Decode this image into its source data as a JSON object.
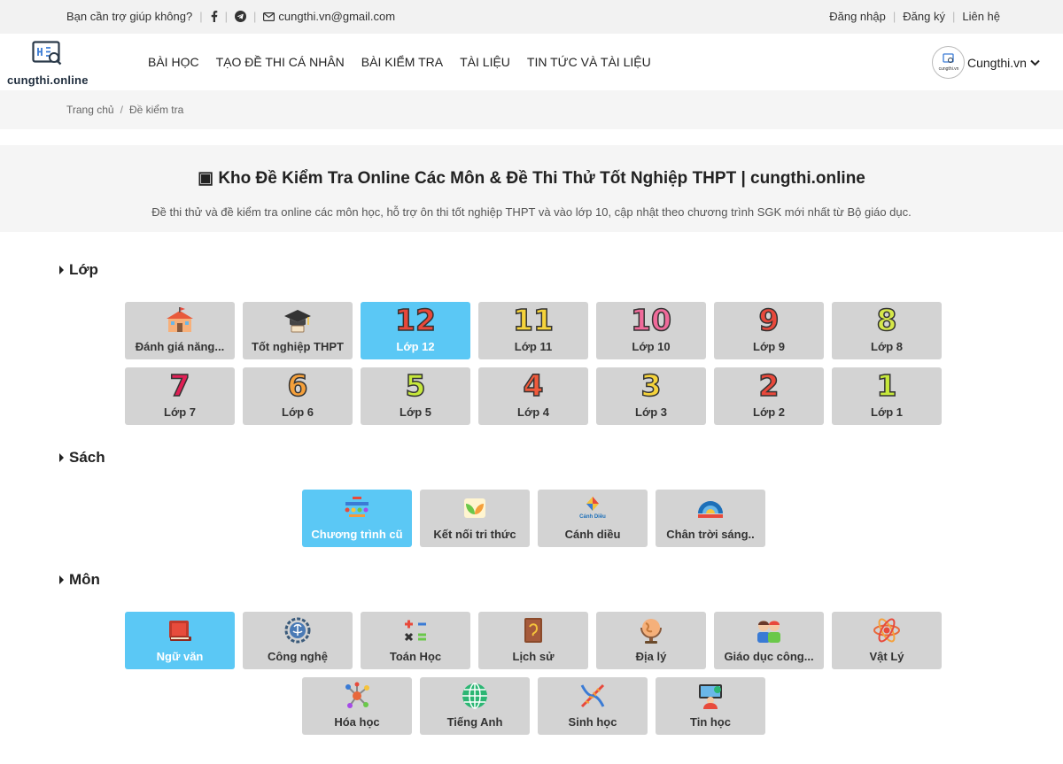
{
  "topbar": {
    "help_text": "Bạn cần trợ giúp không?",
    "email": "cungthi.vn@gmail.com",
    "login": "Đăng nhập",
    "register": "Đăng ký",
    "contact": "Liên hệ"
  },
  "header": {
    "logo_text": "cungthi.online",
    "nav": [
      "BÀI HỌC",
      "TẠO ĐỀ THI CÁ NHÂN",
      "BÀI KIỂM TRA",
      "TÀI LIỆU",
      "TIN TỨC VÀ TÀI LIỆU"
    ],
    "account_name": "Cungthi.vn",
    "avatar_text": "cungthi.vn"
  },
  "breadcrumb": {
    "home": "Trang chủ",
    "current": "Đề kiểm tra"
  },
  "hero": {
    "title": "▣ Kho Đề Kiểm Tra Online Các Môn & Đề Thi Thử Tốt Nghiệp THPT | cungthi.online",
    "subtitle": "Đề thi thử và đề kiểm tra online các môn học, hỗ trợ ôn thi tốt nghiệp THPT và vào lớp 10, cập nhật theo chương trình SGK mới nhất từ Bộ giáo dục."
  },
  "sections": {
    "grades": "Lớp",
    "books": "Sách",
    "subjects": "Môn"
  },
  "grades": [
    {
      "label": "Đánh giá năng...",
      "icon": "school-building-icon"
    },
    {
      "label": "Tốt nghiệp THPT",
      "icon": "graduation-cap-icon"
    },
    {
      "label": "Lớp 12",
      "num": "12",
      "color": "#e8483b",
      "active": true
    },
    {
      "label": "Lớp 11",
      "num": "11",
      "color": "#f5d33b"
    },
    {
      "label": "Lớp 10",
      "num": "10",
      "color": "#f06a9a"
    },
    {
      "label": "Lớp 9",
      "num": "9",
      "color": "#e8483b"
    },
    {
      "label": "Lớp 8",
      "num": "8",
      "color": "#d6e84a"
    },
    {
      "label": "Lớp 7",
      "num": "7",
      "color": "#e01f55"
    },
    {
      "label": "Lớp 6",
      "num": "6",
      "color": "#f5a03b"
    },
    {
      "label": "Lớp 5",
      "num": "5",
      "color": "#c6e83b"
    },
    {
      "label": "Lớp 4",
      "num": "4",
      "color": "#f05a3b"
    },
    {
      "label": "Lớp 3",
      "num": "3",
      "color": "#f5d33b"
    },
    {
      "label": "Lớp 2",
      "num": "2",
      "color": "#e8483b"
    },
    {
      "label": "Lớp 1",
      "num": "1",
      "color": "#c6e83b"
    }
  ],
  "books": [
    {
      "label": "Chương trình cũ",
      "icon": "old-curriculum-icon",
      "active": true
    },
    {
      "label": "Kết nối tri thức",
      "icon": "knowledge-connection-icon"
    },
    {
      "label": "Cánh diều",
      "icon": "kite-icon"
    },
    {
      "label": "Chân trời sáng..",
      "icon": "creative-horizon-icon"
    }
  ],
  "subjects": [
    {
      "label": "Ngữ văn",
      "icon": "books-icon",
      "active": true
    },
    {
      "label": "Công nghệ",
      "icon": "gear-brain-icon"
    },
    {
      "label": "Toán Học",
      "icon": "math-symbols-icon"
    },
    {
      "label": "Lịch sử",
      "icon": "history-book-icon"
    },
    {
      "label": "Địa lý",
      "icon": "globe-icon"
    },
    {
      "label": "Giáo dục công...",
      "icon": "civic-education-icon"
    },
    {
      "label": "Vật Lý",
      "icon": "atom-icon"
    },
    {
      "label": "Hóa học",
      "icon": "molecule-icon"
    },
    {
      "label": "Tiếng Anh",
      "icon": "world-globe-icon"
    },
    {
      "label": "Sinh học",
      "icon": "dna-icon"
    },
    {
      "label": "Tin học",
      "icon": "computer-user-icon"
    }
  ]
}
